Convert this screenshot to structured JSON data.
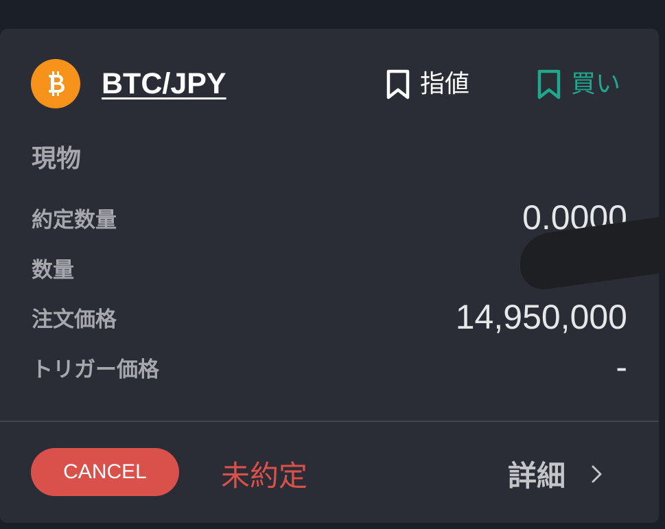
{
  "order": {
    "pair": "BTC/JPY",
    "order_type": "指値",
    "side": "買い",
    "category": "現物"
  },
  "fields": [
    {
      "label": "約定数量",
      "value": "0.0000"
    },
    {
      "label": "数量",
      "value": ""
    },
    {
      "label": "注文価格",
      "value": "14,950,000"
    },
    {
      "label": "トリガー価格",
      "value": "-"
    }
  ],
  "footer": {
    "cancel_label": "CANCEL",
    "status": "未約定",
    "detail_label": "詳細"
  },
  "icons": {
    "coin": "bitcoin-icon",
    "order_type": "bookmark-icon",
    "side": "bookmark-icon",
    "detail": "chevron-right-icon"
  },
  "colors": {
    "background": "#1b1f28",
    "card": "#2a2d35",
    "bitcoin": "#f7931a",
    "buy": "#1fa88e",
    "cancel": "#d9514a",
    "status": "#d9514a"
  }
}
